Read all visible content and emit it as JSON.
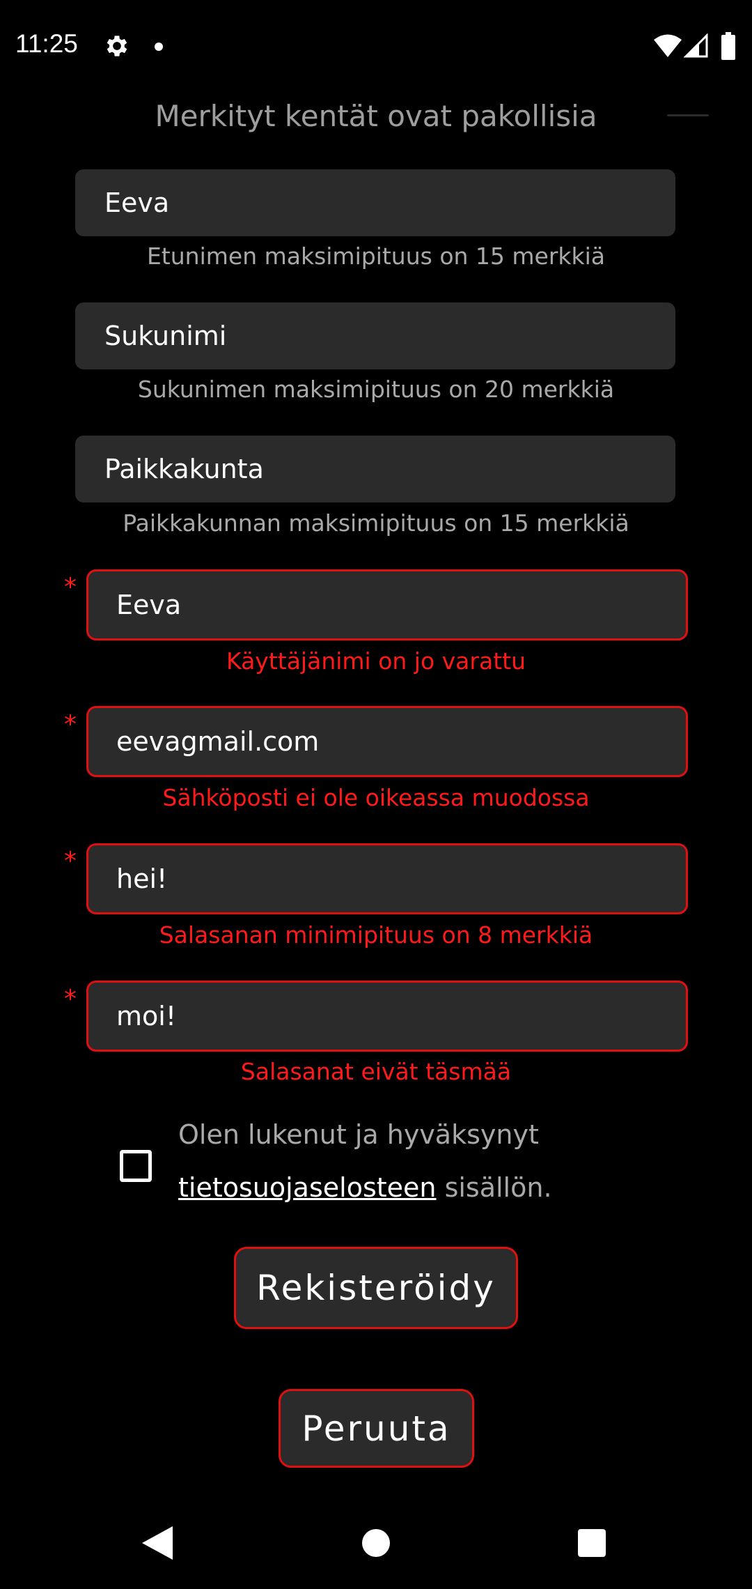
{
  "status_bar": {
    "time": "11:25",
    "icons": [
      "gear-icon",
      "notification-dot-icon",
      "wifi-icon",
      "signal-icon",
      "battery-icon"
    ]
  },
  "form": {
    "heading_partial": "Merkityt kentät ovat pakollisia",
    "first_name": {
      "value": "Eeva",
      "helper": "Etunimen maksimipituus on 15 merkkiä"
    },
    "last_name": {
      "value": "Sukunimi",
      "helper": "Sukunimen maksimipituus on 20 merkkiä"
    },
    "city": {
      "value": "Paikkakunta",
      "helper": "Paikkakunnan maksimipituus on 15 merkkiä"
    },
    "required_marker": "*",
    "username": {
      "value": "Eeva",
      "error": "Käyttäjänimi on jo varattu"
    },
    "email": {
      "value": "eevagmail.com",
      "error": "Sähköposti ei ole oikeassa muodossa"
    },
    "password": {
      "value": "hei!",
      "error": "Salasanan minimipituus on 8 merkkiä"
    },
    "password_confirm": {
      "value": "moi!",
      "error": "Salasanat eivät täsmää"
    },
    "consent": {
      "checked": false,
      "line1": "Olen lukenut ja hyväksynyt",
      "link": "tietosuojaselosteen",
      "suffix": " sisällön."
    },
    "register_label": "Rekisteröidy",
    "cancel_label": "Peruuta"
  },
  "colors": {
    "background": "#000000",
    "field": "#2b2b2b",
    "error": "#e01010",
    "helper": "#a9a9a9"
  }
}
